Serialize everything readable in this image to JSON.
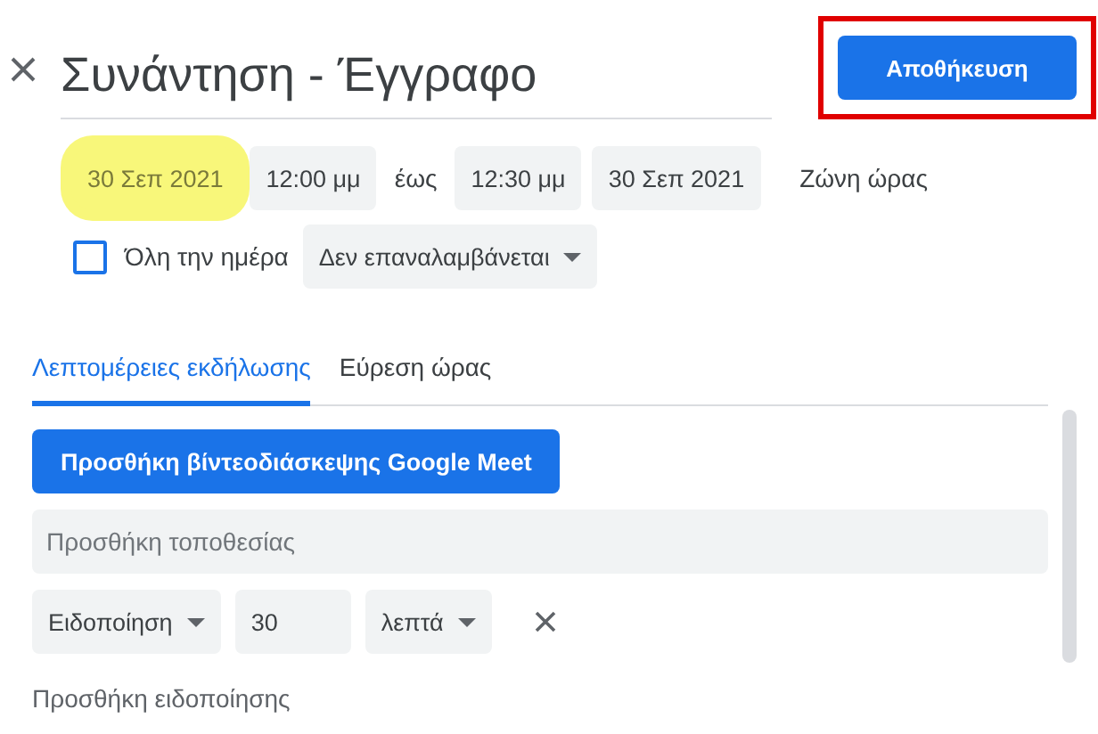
{
  "title": "Συνάντηση - Έγγραφο",
  "save_button": {
    "label": "Αποθήκευση",
    "outlined": true
  },
  "start_date": {
    "value": "30 Σεπ 2021",
    "highlighted": true
  },
  "start_time": "12:00 μμ",
  "until": "έως",
  "end_time": "12:30 μμ",
  "end_date": "30 Σεπ 2021",
  "timezone_link": "Ζώνη ώρας",
  "all_day": {
    "label": "Όλη την ημέρα",
    "checked": false
  },
  "repeat": "Δεν επαναλαμβάνεται",
  "tabs": [
    {
      "label": "Λεπτομέρειες εκδήλωσης",
      "selected": true
    },
    {
      "label": "Εύρεση ώρας",
      "selected": false
    }
  ],
  "meet_button": "Προσθήκη βίντεοδιάσκεψης Google Meet",
  "location": {
    "placeholder": "Προσθήκη τοποθεσίας"
  },
  "notification": {
    "type": "Ειδοποίηση",
    "amount": "30",
    "unit": "λεπτά"
  },
  "add_notification": "Προσθήκη ειδοποίησης"
}
